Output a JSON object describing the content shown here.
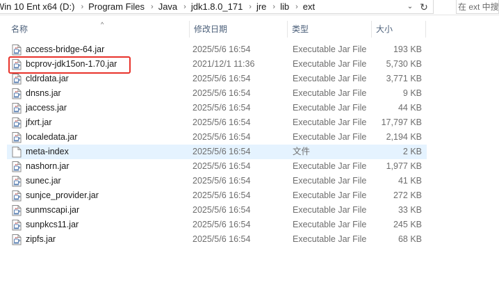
{
  "address_bar": {
    "crumbs": [
      "Win 10 Ent x64 (D:)",
      "Program Files",
      "Java",
      "jdk1.8.0_171",
      "jre",
      "lib",
      "ext"
    ],
    "separator": "›",
    "dropdown_glyph": "⌄",
    "refresh_glyph": "↻",
    "search_placeholder": "在 ext 中搜索"
  },
  "columns": {
    "name": "名称",
    "date": "修改日期",
    "type": "类型",
    "size": "大小",
    "sort_glyph": "^"
  },
  "files": [
    {
      "name": "access-bridge-64.jar",
      "date": "2025/5/6 16:54",
      "type": "Executable Jar File",
      "size": "193 KB",
      "icon": "jar-file-icon"
    },
    {
      "name": "bcprov-jdk15on-1.70.jar",
      "date": "2021/12/1 11:36",
      "type": "Executable Jar File",
      "size": "5,730 KB",
      "icon": "jar-file-icon"
    },
    {
      "name": "cldrdata.jar",
      "date": "2025/5/6 16:54",
      "type": "Executable Jar File",
      "size": "3,771 KB",
      "icon": "jar-file-icon"
    },
    {
      "name": "dnsns.jar",
      "date": "2025/5/6 16:54",
      "type": "Executable Jar File",
      "size": "9 KB",
      "icon": "jar-file-icon"
    },
    {
      "name": "jaccess.jar",
      "date": "2025/5/6 16:54",
      "type": "Executable Jar File",
      "size": "44 KB",
      "icon": "jar-file-icon"
    },
    {
      "name": "jfxrt.jar",
      "date": "2025/5/6 16:54",
      "type": "Executable Jar File",
      "size": "17,797 KB",
      "icon": "jar-file-icon"
    },
    {
      "name": "localedata.jar",
      "date": "2025/5/6 16:54",
      "type": "Executable Jar File",
      "size": "2,194 KB",
      "icon": "jar-file-icon"
    },
    {
      "name": "meta-index",
      "date": "2025/5/6 16:54",
      "type": "文件",
      "size": "2 KB",
      "icon": "blank-file-icon"
    },
    {
      "name": "nashorn.jar",
      "date": "2025/5/6 16:54",
      "type": "Executable Jar File",
      "size": "1,977 KB",
      "icon": "jar-file-icon"
    },
    {
      "name": "sunec.jar",
      "date": "2025/5/6 16:54",
      "type": "Executable Jar File",
      "size": "41 KB",
      "icon": "jar-file-icon"
    },
    {
      "name": "sunjce_provider.jar",
      "date": "2025/5/6 16:54",
      "type": "Executable Jar File",
      "size": "272 KB",
      "icon": "jar-file-icon"
    },
    {
      "name": "sunmscapi.jar",
      "date": "2025/5/6 16:54",
      "type": "Executable Jar File",
      "size": "33 KB",
      "icon": "jar-file-icon"
    },
    {
      "name": "sunpkcs11.jar",
      "date": "2025/5/6 16:54",
      "type": "Executable Jar File",
      "size": "245 KB",
      "icon": "jar-file-icon"
    },
    {
      "name": "zipfs.jar",
      "date": "2025/5/6 16:54",
      "type": "Executable Jar File",
      "size": "68 KB",
      "icon": "jar-file-icon"
    }
  ],
  "highlighted_row": 7,
  "annotated_row": 1,
  "colors": {
    "highlight": "#e5f3ff",
    "annotation": "#e8322a",
    "header_text": "#4c607a"
  }
}
